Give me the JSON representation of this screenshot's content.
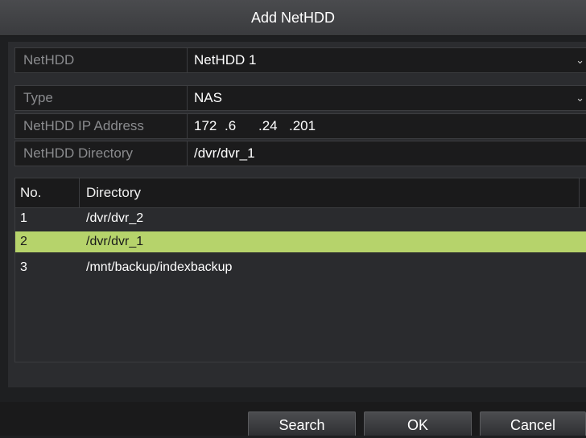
{
  "dialog": {
    "title": "Add NetHDD"
  },
  "fields": {
    "nethdd": {
      "label": "NetHDD",
      "value": "NetHDD 1"
    },
    "type": {
      "label": "Type",
      "value": "NAS"
    },
    "ip": {
      "label": "NetHDD IP Address",
      "octets": [
        "172",
        ".6",
        ".24",
        ".201"
      ]
    },
    "directory": {
      "label": "NetHDD Directory",
      "value": "/dvr/dvr_1"
    }
  },
  "table": {
    "headers": [
      "No.",
      "Directory"
    ],
    "rows": [
      {
        "no": "1",
        "dir": "/dvr/dvr_2"
      },
      {
        "no": "2",
        "dir": "/dvr/dvr_1"
      },
      {
        "no": "3",
        "dir": "/mnt/backup/indexbackup"
      }
    ],
    "selected_row": 2
  },
  "buttons": {
    "search": "Search",
    "ok": "OK",
    "cancel": "Cancel"
  },
  "icons": {
    "dropdown": "chevron-down-icon"
  },
  "colors": {
    "selection": "#b6d36b"
  }
}
